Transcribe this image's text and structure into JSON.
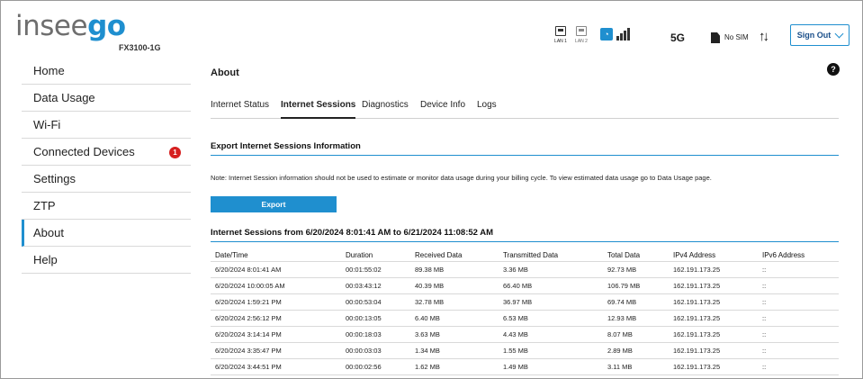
{
  "brand": {
    "logo_main": "insee",
    "logo_accent": "go",
    "model": "FX3100-1G"
  },
  "status": {
    "lan1": "LAN 1",
    "lan2": "LAN 2",
    "network_type": "5G",
    "sim": "No SIM",
    "data_activity": "↑↓",
    "wifi_icon": "wifi-status-icon",
    "signal_icon": "signal-bars-icon"
  },
  "header": {
    "sign_out": "Sign Out"
  },
  "sidebar": {
    "items": [
      {
        "label": "Home"
      },
      {
        "label": "Data Usage"
      },
      {
        "label": "Wi-Fi"
      },
      {
        "label": "Connected Devices",
        "badge": "1"
      },
      {
        "label": "Settings"
      },
      {
        "label": "ZTP"
      },
      {
        "label": "About"
      },
      {
        "label": "Help"
      }
    ]
  },
  "main": {
    "title": "About",
    "help": "?",
    "tabs": [
      {
        "label": "Internet Status"
      },
      {
        "label": "Internet Sessions"
      },
      {
        "label": "Diagnostics"
      },
      {
        "label": "Device Info"
      },
      {
        "label": "Logs"
      }
    ],
    "export_title": "Export Internet Sessions Information",
    "note": "Note: Internet Session information should not be used to estimate or monitor data usage during your billing cycle. To view estimated data usage go to Data Usage page.",
    "export_button": "Export",
    "sessions_title": "Internet Sessions from 6/20/2024 8:01:41 AM to 6/21/2024 11:08:52 AM"
  },
  "table": {
    "columns": [
      "Date/Time",
      "Duration",
      "Received Data",
      "Transmitted Data",
      "Total Data",
      "IPv4 Address",
      "IPv6 Address"
    ],
    "rows": [
      [
        "6/20/2024 8:01:41 AM",
        "00:01:55:02",
        "89.38 MB",
        "3.36 MB",
        "92.73 MB",
        "162.191.173.25",
        "::"
      ],
      [
        "6/20/2024 10:00:05 AM",
        "00:03:43:12",
        "40.39 MB",
        "66.40 MB",
        "106.79 MB",
        "162.191.173.25",
        "::"
      ],
      [
        "6/20/2024 1:59:21 PM",
        "00:00:53:04",
        "32.78 MB",
        "36.97 MB",
        "69.74 MB",
        "162.191.173.25",
        "::"
      ],
      [
        "6/20/2024 2:56:12 PM",
        "00:00:13:05",
        "6.40 MB",
        "6.53 MB",
        "12.93 MB",
        "162.191.173.25",
        "::"
      ],
      [
        "6/20/2024 3:14:14 PM",
        "00:00:18:03",
        "3.63 MB",
        "4.43 MB",
        "8.07 MB",
        "162.191.173.25",
        "::"
      ],
      [
        "6/20/2024 3:35:47 PM",
        "00:00:03:03",
        "1.34 MB",
        "1.55 MB",
        "2.89 MB",
        "162.191.173.25",
        "::"
      ],
      [
        "6/20/2024 3:44:51 PM",
        "00:00:02:56",
        "1.62 MB",
        "1.49 MB",
        "3.11 MB",
        "162.191.173.25",
        "::"
      ]
    ]
  },
  "colors": {
    "accent": "#1f8fcf",
    "badge": "#d62020",
    "text": "#1a1a1a"
  }
}
